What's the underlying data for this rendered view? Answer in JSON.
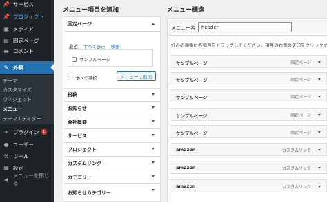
{
  "sidebar": {
    "items": [
      {
        "label": "サービス",
        "icon": "thumbtack-icon"
      },
      {
        "label": "プロジェクト",
        "icon": "thumbtack-icon"
      },
      {
        "label": "メディア",
        "icon": "media-icon"
      },
      {
        "label": "固定ページ",
        "icon": "page-icon"
      },
      {
        "label": "コメント",
        "icon": "comment-icon"
      },
      {
        "label": "外観",
        "icon": "brush-icon"
      },
      {
        "label": "プラグイン",
        "icon": "plugin-icon",
        "badge": "1"
      },
      {
        "label": "ユーザー",
        "icon": "user-icon"
      },
      {
        "label": "ツール",
        "icon": "wrench-icon"
      },
      {
        "label": "設定",
        "icon": "settings-icon"
      },
      {
        "label": "メニューを閉じる",
        "icon": "collapse-icon"
      }
    ],
    "submenu": [
      "テーマ",
      "カスタマイズ",
      "ウィジェット",
      "メニュー",
      "テーマエディター"
    ]
  },
  "add_panel": {
    "heading": "メニュー項目を追加",
    "open_section": "固定ページ",
    "tabs": [
      "最近",
      "すべて表示",
      "検索"
    ],
    "checkbox_item": "サンプルページ",
    "select_all": "すべて選択",
    "add_button": "メニューに追加",
    "sections": [
      "投稿",
      "お知らせ",
      "会社概要",
      "サービス",
      "プロジェクト",
      "カスタムリンク",
      "カテゴリー",
      "お知らせカテゴリー"
    ]
  },
  "structure": {
    "heading": "メニュー構造",
    "name_label": "メニュー名",
    "name_value": "header",
    "instructions": "好みの順番に各項目をドラッグしてください。項目の右側の矢印をクリックす",
    "items": [
      {
        "title": "サンプルページ",
        "type": "固定ページ"
      },
      {
        "title": "サンプルページ",
        "type": "固定ページ"
      },
      {
        "title": "サンプルページ",
        "type": "固定ページ"
      },
      {
        "title": "サンプルページ",
        "type": "固定ページ"
      },
      {
        "title": "サンプルページ",
        "type": "固定ページ"
      },
      {
        "title": "amazon",
        "type": "カスタムリンク"
      },
      {
        "title": "amazon",
        "type": "カスタムリンク"
      },
      {
        "title": "amazon",
        "type": "カスタムリンク"
      }
    ]
  },
  "colors": {
    "sidebar": "#1d2327",
    "accent": "#2271b1",
    "badge": "#d63638"
  }
}
